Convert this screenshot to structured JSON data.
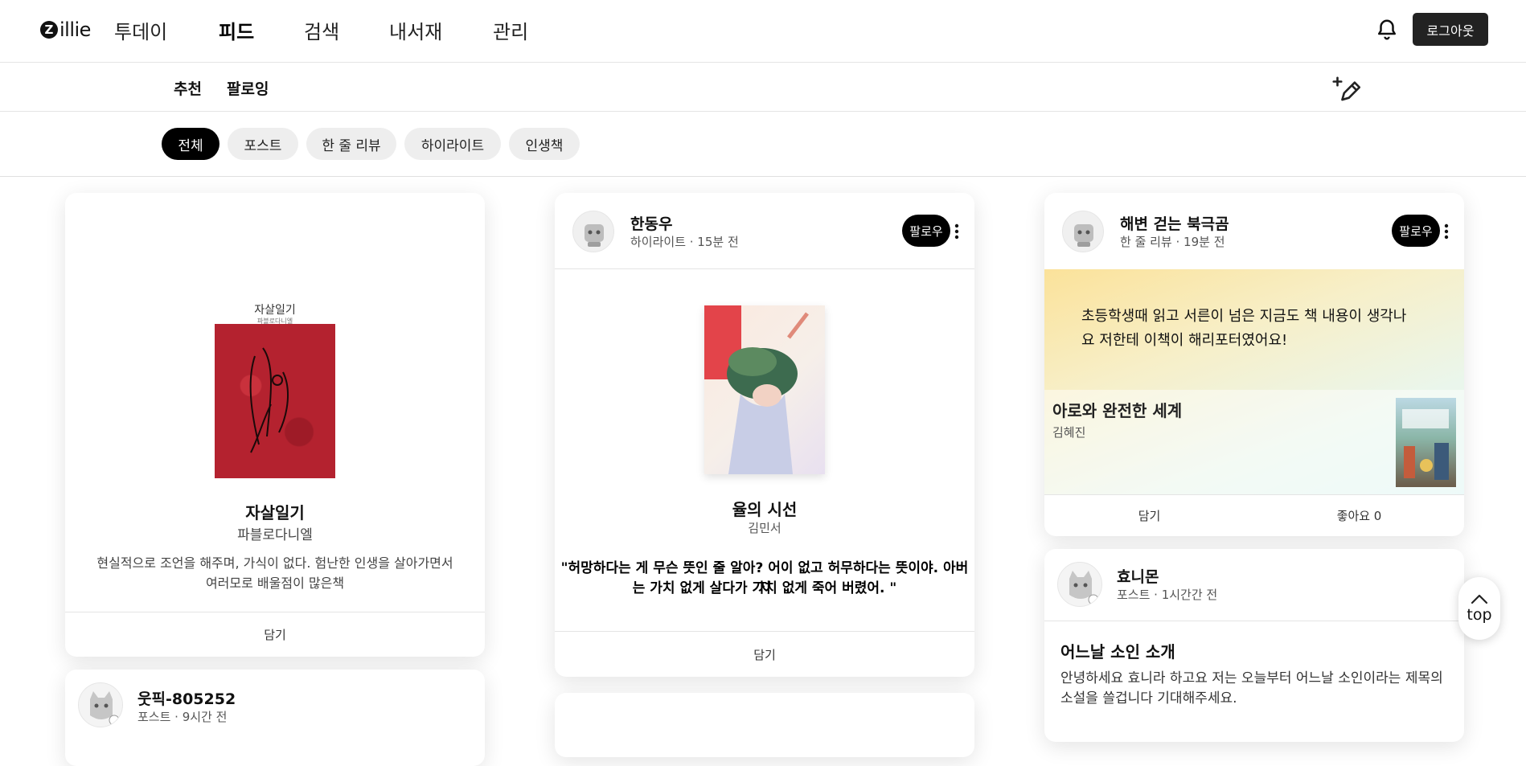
{
  "app": {
    "logo_mark": "Z",
    "logo_text": "illie"
  },
  "nav": {
    "tabs": [
      "투데이",
      "피드",
      "검색",
      "내서재",
      "관리"
    ],
    "active": "피드",
    "logout": "로그아웃"
  },
  "subnav": {
    "tabs": [
      "추천",
      "팔로잉"
    ]
  },
  "filters": {
    "chips": [
      "전체",
      "포스트",
      "한 줄 리뷰",
      "하이라이트",
      "인생책"
    ],
    "active": "전체"
  },
  "cards": {
    "book": {
      "cover_title": "자살일기",
      "cover_subtitle": "파블로다니엘",
      "cover_color": "#b4222f",
      "title": "자살일기",
      "author": "파블로다니엘",
      "description_line1": "현실적으로 조언을 해주며, 가식이 없다. 험난한 인생을 살아가면서",
      "description_line2": "여러모로 배울점이 많은책",
      "action": "담기"
    },
    "highlight": {
      "user": "한동우",
      "meta": "하이라이트 · 15분 전",
      "follow": "팔로우",
      "book_title": "율의 시선",
      "author": "김민서",
      "quote_line1": "\"허망하다는 게 무슨 뜻인 줄 알아? 어이 없고 허무하다는 뜻이야. 아버지",
      "quote_line2": "는 가치 없게 살다가 가치 없게 죽어 버렸어. \"",
      "action": "담기"
    },
    "review": {
      "user": "해변 걷는 북극곰",
      "meta": "한 줄 리뷰 · 19분 전",
      "follow": "팔로우",
      "text_line1": "초등학생때 읽고 서른이 넘은 지금도 책 내용이 생각나",
      "text_line2": "요 저한테 이책이 해리포터였어요!",
      "book_title": "아로와 완전한 세계",
      "author": "김혜진",
      "action": "담기",
      "likes": "좋아요 0"
    },
    "post_right": {
      "user": "효니몬",
      "meta": "포스트 · 1시간간 전",
      "title": "어느날 소인 소개",
      "body_line1": "안녕하세요 효니라 하고요 저는 오늘부터 어느날 소인이라는 제목의",
      "body_line2": "소설을 쓸겁니다 기대해주세요."
    },
    "post_left": {
      "user": "웃픽-805252",
      "meta": "포스트 · 9시간 전"
    }
  },
  "scroll_top": "top",
  "colors": {
    "accent": "#000000",
    "chip_bg": "#eeeeee"
  }
}
